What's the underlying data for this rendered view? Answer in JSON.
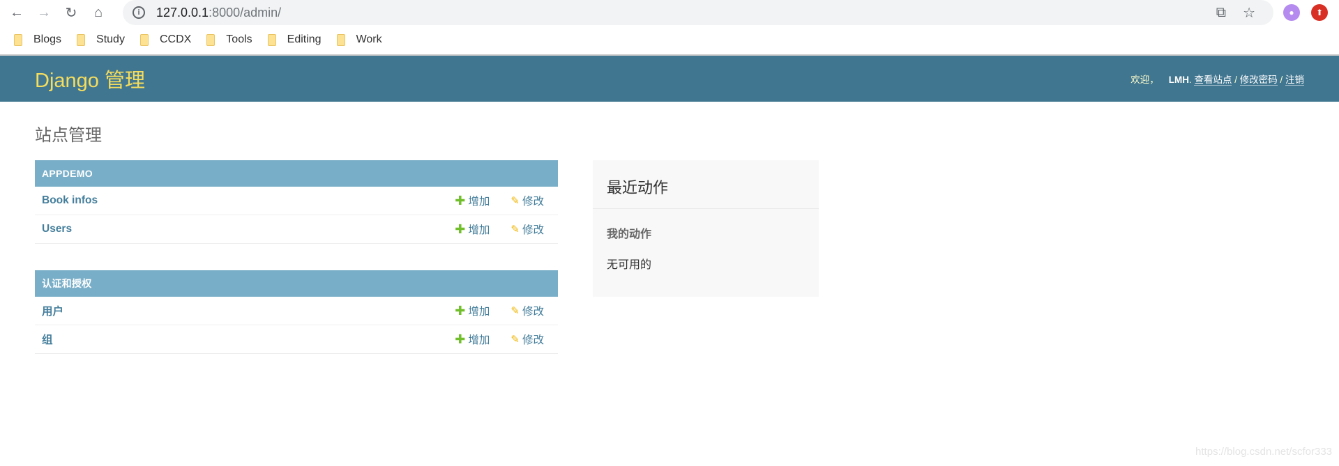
{
  "browser": {
    "url_host": "127.0.0.1",
    "url_rest": ":8000/admin/",
    "bookmarks": [
      "Blogs",
      "Study",
      "CCDX",
      "Tools",
      "Editing",
      "Work"
    ]
  },
  "header": {
    "brand": "Django 管理",
    "welcome": "欢迎，",
    "username": "LMH",
    "dot": ". ",
    "view_site": "查看站点",
    "sep": " / ",
    "change_password": "修改密码",
    "logout": "注销"
  },
  "page_title": "站点管理",
  "modules": [
    {
      "title": "APPDEMO",
      "rows": [
        {
          "name": "Book infos"
        },
        {
          "name": "Users"
        }
      ]
    },
    {
      "title": "认证和授权",
      "rows": [
        {
          "name": "用户"
        },
        {
          "name": "组"
        }
      ]
    }
  ],
  "actions": {
    "add": "增加",
    "change": "修改"
  },
  "recent": {
    "title": "最近动作",
    "subtitle": "我的动作",
    "empty": "无可用的"
  },
  "watermark": "https://blog.csdn.net/scfor333",
  "colors": {
    "header": "#417690",
    "brand": "#f5dd5d",
    "module_head": "#79aec8",
    "link": "#447e9b",
    "add": "#70bf2b",
    "change": "#efb80b"
  }
}
